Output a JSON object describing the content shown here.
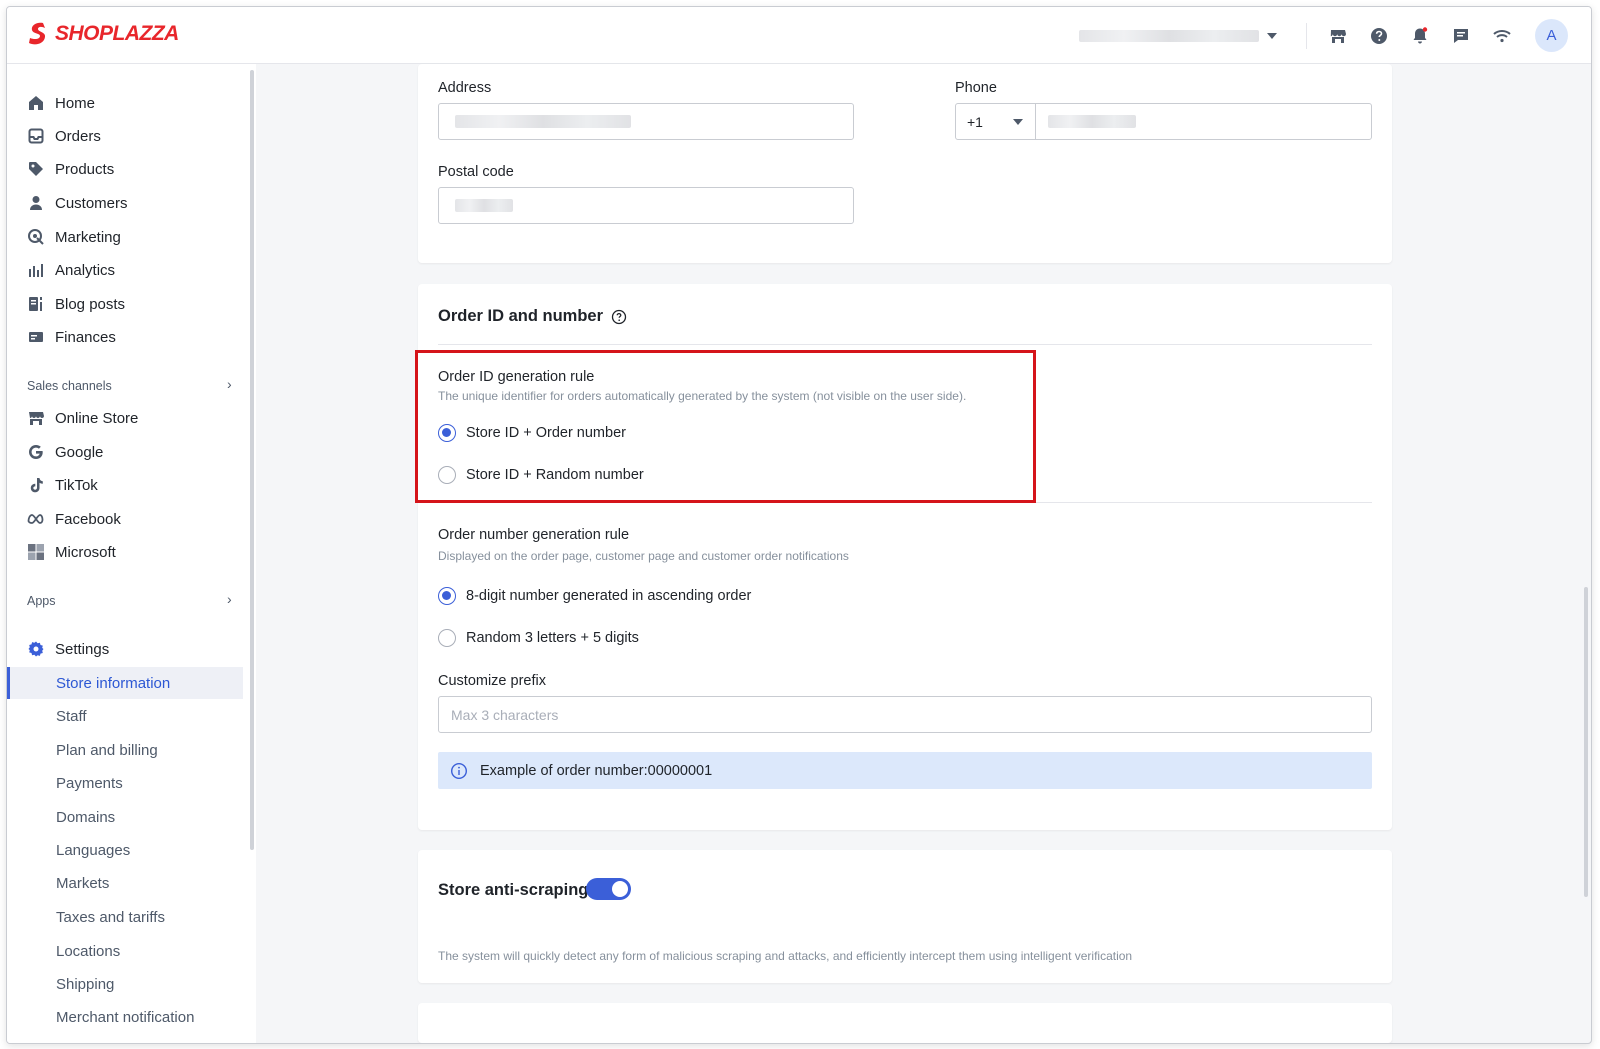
{
  "brand": {
    "name": "SHOPLAZZA",
    "color": "#e8262b"
  },
  "topbar": {
    "icons": [
      "store-icon",
      "help-icon",
      "bell-icon",
      "chat-icon",
      "wifi-icon"
    ],
    "avatar_initial": "A"
  },
  "sidebar": {
    "main_items": [
      {
        "label": "Home",
        "icon": "home-icon"
      },
      {
        "label": "Orders",
        "icon": "orders-icon"
      },
      {
        "label": "Products",
        "icon": "tag-icon"
      },
      {
        "label": "Customers",
        "icon": "person-icon"
      },
      {
        "label": "Marketing",
        "icon": "marketing-icon"
      },
      {
        "label": "Analytics",
        "icon": "analytics-icon"
      },
      {
        "label": "Blog posts",
        "icon": "blog-icon"
      },
      {
        "label": "Finances",
        "icon": "finance-icon"
      }
    ],
    "sales_channels_label": "Sales channels",
    "channels": [
      {
        "label": "Online Store",
        "icon": "store-icon"
      },
      {
        "label": "Google",
        "icon": "google-icon"
      },
      {
        "label": "TikTok",
        "icon": "tiktok-icon"
      },
      {
        "label": "Facebook",
        "icon": "meta-icon"
      },
      {
        "label": "Microsoft",
        "icon": "microsoft-icon"
      }
    ],
    "apps_label": "Apps",
    "settings_label": "Settings",
    "settings_items": [
      "Store information",
      "Staff",
      "Plan and billing",
      "Payments",
      "Domains",
      "Languages",
      "Markets",
      "Taxes and tariffs",
      "Locations",
      "Shipping",
      "Merchant notification"
    ]
  },
  "address_card": {
    "address_label": "Address",
    "phone_label": "Phone",
    "phone_code": "+1",
    "postal_label": "Postal code"
  },
  "order_card": {
    "title": "Order ID and number",
    "id_rule": {
      "title": "Order ID generation rule",
      "desc": "The unique identifier for orders automatically generated by the system (not visible on the user side).",
      "options": [
        "Store ID + Order number",
        "Store ID + Random number"
      ],
      "selected": 0
    },
    "number_rule": {
      "title": "Order number generation rule",
      "desc": "Displayed on the order page, customer page and customer order notifications",
      "options": [
        "8-digit number generated in ascending order",
        "Random 3 letters + 5 digits"
      ],
      "selected": 0
    },
    "prefix_label": "Customize prefix",
    "prefix_placeholder": "Max 3 characters",
    "example_text": "Example of order number:00000001"
  },
  "anti_scraping": {
    "title": "Store anti-scraping",
    "enabled": true,
    "desc": "The system will quickly detect any form of malicious scraping and attacks, and efficiently intercept them using intelligent verification"
  },
  "colors": {
    "accent": "#3b5fd8",
    "highlight": "#d5141a",
    "info_bg": "#dce8fb"
  }
}
